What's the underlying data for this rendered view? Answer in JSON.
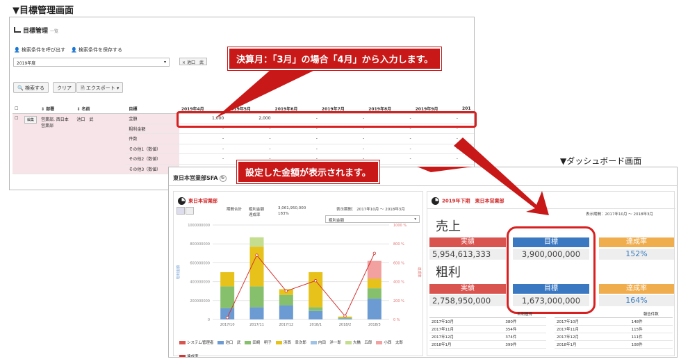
{
  "headings": {
    "goal": "▼目標管理画面",
    "dash": "▼ダッシュボード画面"
  },
  "goal": {
    "title": "目標管理",
    "subtitle": "一覧",
    "load_search": "検索条件を呼び出す",
    "save_search": "検索条件を保存する",
    "year": "2019年度",
    "tag": "池口　武",
    "btn_search": "検索する",
    "btn_clear": "クリア",
    "btn_export": "エクスポート",
    "cols": {
      "dept": "部署",
      "name": "名前",
      "target": "目標"
    },
    "months": [
      "2019年4月",
      "2019年5月",
      "2019年6月",
      "2019年7月",
      "2019年8月",
      "2019年9月",
      "201"
    ],
    "edit": "編集",
    "dept_val": "営業部, 西日本営業部",
    "name_val": "池口　武",
    "rows": [
      {
        "label": "金額",
        "vals": [
          "1,000",
          "2,000",
          "-",
          "-",
          "-",
          "-"
        ]
      },
      {
        "label": "粗利金額",
        "vals": [
          "-",
          "-",
          "-",
          "-",
          "-",
          "-"
        ]
      },
      {
        "label": "件数",
        "vals": [
          "-",
          "-",
          "-",
          "-",
          "-",
          "-"
        ]
      },
      {
        "label": "その他1（数値）",
        "vals": [
          "-",
          "-",
          "-",
          "-",
          "-",
          "-"
        ]
      },
      {
        "label": "その他2（数値）",
        "vals": [
          "-",
          "-",
          "-",
          "-",
          "-",
          "-"
        ]
      },
      {
        "label": "その他3（数値）",
        "vals": [
          "-",
          "-",
          "-",
          "-",
          "-",
          "-"
        ]
      }
    ]
  },
  "callouts": {
    "c1": "決算月：「3月」の場合「4月」から入力します。",
    "c2": "設定した金額が表示されます。"
  },
  "dash": {
    "title": "東日本営業部SFA",
    "left": {
      "header": "東日本営業部",
      "l1": "期間合計",
      "l2": "粗利金額",
      "v2": "3,061,950,000",
      "l3": "達成率",
      "v3": "183%",
      "period": "表示期間： 2017年10月 〜 2018年3月",
      "select": "粗利金額",
      "ylabel": "粗利金額",
      "y2label": "達成率"
    },
    "right": {
      "header": "2019年下期　東日本営業部",
      "period": "表示期間：2017年10月 〜 2018年3月",
      "sales": "売上",
      "gross": "粗利",
      "actual": "実績",
      "target": "目標",
      "rate": "達成率",
      "sales_actual": "5,954,613,333",
      "sales_target": "3,900,000,000",
      "sales_rate": "152%",
      "gross_actual": "2,758,950,000",
      "gross_target": "1,673,000,000",
      "gross_rate": "164%",
      "t1": {
        "h": "名刺獲得",
        "rows": [
          [
            "2017年10月",
            "380件"
          ],
          [
            "2017年11月",
            "354件"
          ],
          [
            "2017年12月",
            "374件"
          ],
          [
            "2018年1月",
            "399件"
          ]
        ]
      },
      "t2": {
        "h": "報告件数",
        "rows": [
          [
            "2017年10月",
            "148件"
          ],
          [
            "2017年11月",
            "115件"
          ],
          [
            "2017年12月",
            "111件"
          ],
          [
            "2018年1月",
            "108件"
          ]
        ]
      }
    }
  },
  "chart_data": {
    "type": "bar",
    "categories": [
      "2017/10",
      "2017/11",
      "2017/12",
      "2018/1",
      "2018/2",
      "2018/3"
    ],
    "ylim": [
      0,
      1000000000
    ],
    "y_ticks": [
      "1000000000",
      "800000000",
      "600000000",
      "400000000",
      "200000000",
      "0"
    ],
    "y2_ticks": [
      "1000 %",
      "800 %",
      "600 %",
      "400 %",
      "200 %",
      "0 %"
    ],
    "series": [
      {
        "name": "池口　武",
        "color": "#6b9bd2",
        "values": [
          120000000,
          130000000,
          150000000,
          90000000,
          10000000,
          220000000
        ]
      },
      {
        "name": "田崎　明子",
        "color": "#86c06c",
        "values": [
          230000000,
          220000000,
          110000000,
          40000000,
          8000000,
          110000000
        ]
      },
      {
        "name": "浜西　幸次郎",
        "color": "#e6c21a",
        "values": [
          150000000,
          420000000,
          60000000,
          370000000,
          12000000,
          100000000
        ]
      },
      {
        "name": "大橋　五郎",
        "color": "#c5dd8e",
        "values": [
          0,
          100000000,
          0,
          0,
          0,
          0
        ]
      },
      {
        "name": "小西　太郎",
        "color": "#f2a0a0",
        "values": [
          0,
          0,
          0,
          0,
          0,
          190000000
        ]
      }
    ],
    "legend": [
      "システム管理者",
      "池口　武",
      "田崎　明子",
      "浜西　幸次郎",
      "内田　洋一郎",
      "大橋　五郎",
      "小西　太郎",
      "達成率"
    ],
    "rate": [
      20,
      680,
      300,
      410,
      35,
      700
    ]
  }
}
